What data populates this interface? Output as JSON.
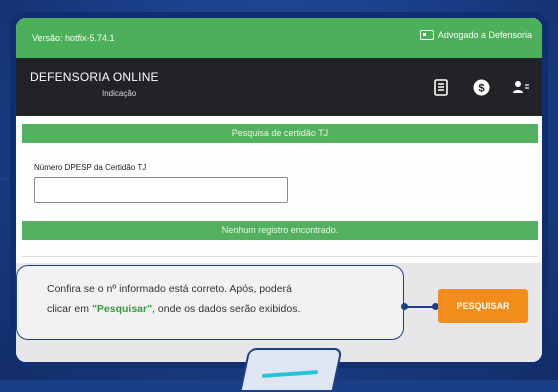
{
  "topbar": {
    "version": "Versão: hotfix-5.74.1",
    "lawyer_link": "Advogado a Defensoria"
  },
  "navbar": {
    "brand": "DEFENSORIA ONLINE",
    "brand_sub": "Indicação",
    "icons": [
      "document-icon",
      "dollar-icon",
      "user-switch-icon"
    ]
  },
  "search": {
    "section_title": "Pesquisa de certidão TJ",
    "field_label": "Número DPESP da Certidão TJ",
    "field_value": "",
    "result_message": "Nenhum registro encontrado."
  },
  "callout": {
    "line1": "Confira se o nº informado está correto. Após, poderá",
    "line2_prefix": "clicar em ",
    "line2_highlight": "\"Pesquisar\"",
    "line2_suffix": ", onde os dados serão exibidos."
  },
  "button": {
    "search_label": "PESQUISAR"
  },
  "colors": {
    "green": "#4caf5a",
    "dark": "#222327",
    "orange": "#f28c1a",
    "navy": "#1b3f86"
  }
}
